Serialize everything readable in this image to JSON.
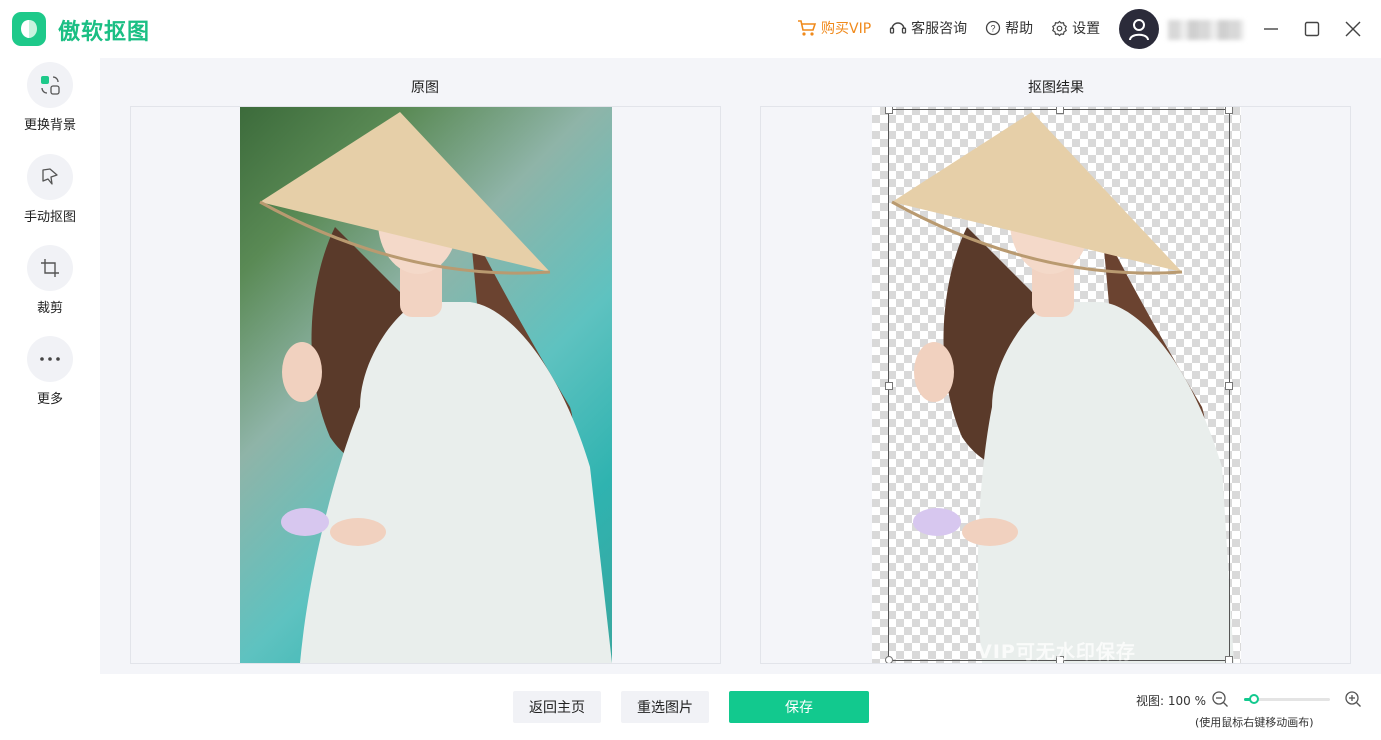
{
  "app": {
    "title": "傲软抠图"
  },
  "top_actions": {
    "buy_vip": "购买VIP",
    "support": "客服咨询",
    "help": "帮助",
    "settings": "设置"
  },
  "sidebar": {
    "items": [
      {
        "label": "更换背景",
        "icon": "change-background-icon"
      },
      {
        "label": "手动抠图",
        "icon": "manual-cutout-icon"
      },
      {
        "label": "裁剪",
        "icon": "crop-icon"
      },
      {
        "label": "更多",
        "icon": "more-icon"
      }
    ]
  },
  "panels": {
    "original_title": "原图",
    "result_title": "抠图结果",
    "watermark": "VIP可无水印保存"
  },
  "bottom": {
    "back_home": "返回主页",
    "reselect": "重选图片",
    "save": "保存"
  },
  "zoom": {
    "label": "视图: 100 %",
    "hint": "(使用鼠标右键移动画布)",
    "level_fraction": 0.12
  },
  "colors": {
    "brand": "#1bbf84",
    "vip": "#f08a1c",
    "save_button": "#12c98e"
  }
}
